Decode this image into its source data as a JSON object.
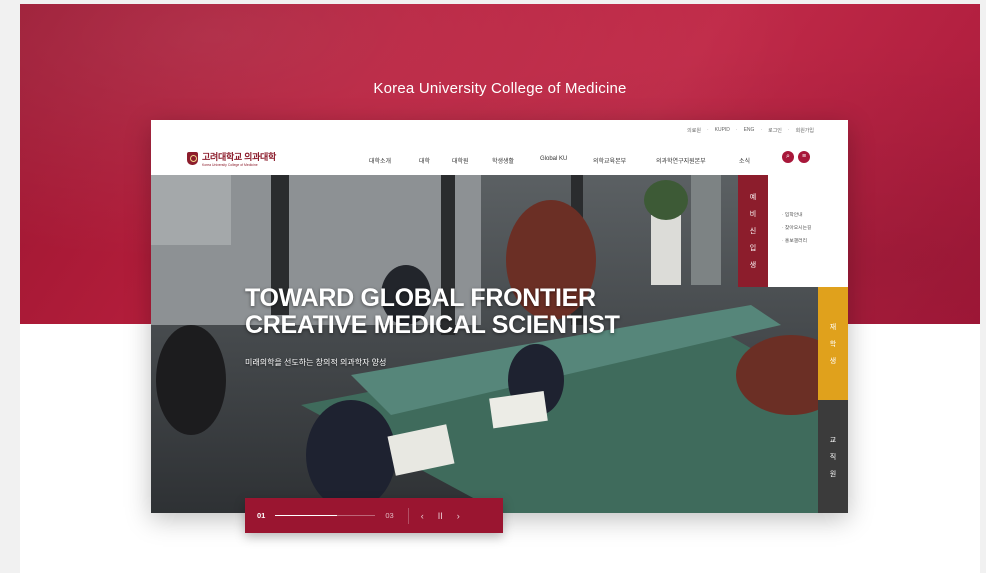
{
  "caption": "Korea University College of Medicine",
  "site": {
    "logo_ko": "고려대학교 의과대학",
    "logo_en": "Korea University College of Medicine",
    "util_links": [
      "의료원",
      "KUPID",
      "ENG",
      "로그인",
      "회원가입"
    ],
    "nav": [
      "대학소개",
      "대학",
      "대학원",
      "학생생활",
      "Global KU",
      "의학교육본부",
      "의과학연구지원본부",
      "소식"
    ],
    "search_icon": "search-icon",
    "menu_icon": "hamburger-menu-icon"
  },
  "hero": {
    "title_line1": "TOWARD GLOBAL FRONTIER",
    "title_line2": "CREATIVE MEDICAL SCIENTIST",
    "subtitle": "미래의학을 선도하는 창의적 의과학자 양성"
  },
  "side": {
    "prospective": [
      "예",
      "비",
      "신",
      "입",
      "생"
    ],
    "prospective_links": [
      "· 입학안내",
      "· 찾아오시는길",
      "· 홍보갤러리"
    ],
    "students": [
      "재",
      "학",
      "생"
    ],
    "faculty": [
      "교",
      "직",
      "원"
    ]
  },
  "pager": {
    "current": "01",
    "total": "03",
    "progress": 0.62,
    "prev": "‹",
    "pause": "II",
    "next": "›"
  },
  "colors": {
    "crimson": "#9a1530",
    "gold": "#e0a11c",
    "dark": "#3b3b3b"
  }
}
